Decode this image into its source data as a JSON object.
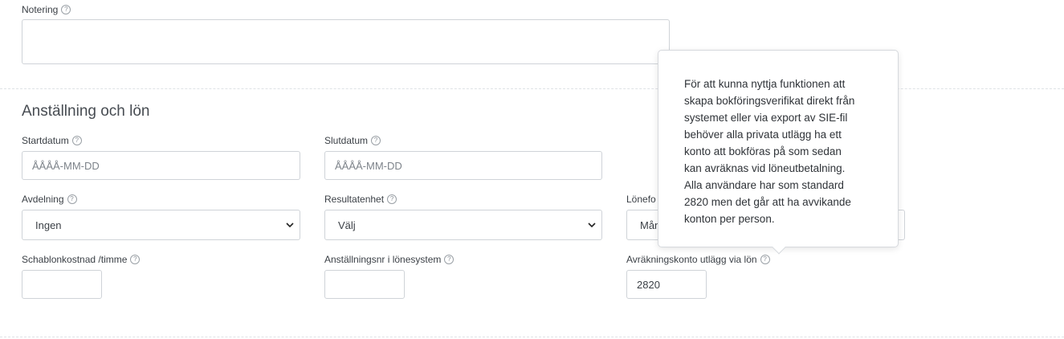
{
  "notes": {
    "label": "Notering",
    "value": ""
  },
  "section": {
    "title": "Anställning och lön"
  },
  "fields": {
    "start_date": {
      "label": "Startdatum",
      "placeholder": "ÅÅÅÅ-MM-DD"
    },
    "end_date": {
      "label": "Slutdatum",
      "placeholder": "ÅÅÅÅ-MM-DD"
    },
    "department": {
      "label": "Avdelning",
      "value": "Ingen"
    },
    "result_unit": {
      "label": "Resultatenhet",
      "value": "Välj"
    },
    "salary_form": {
      "label": "Lönefo",
      "value": "Mån"
    },
    "standard_cost": {
      "label": "Schablonkostnad /timme",
      "value": ""
    },
    "employee_number": {
      "label": "Anställningsnr i lönesystem",
      "value": ""
    },
    "settlement_account": {
      "label": "Avräkningskonto utlägg via lön",
      "value": "2820"
    }
  },
  "tooltip": {
    "lines": [
      "För att kunna nyttja funktionen att",
      "skapa bokföringsverifikat direkt från",
      "systemet eller via export av SIE-fil",
      "behöver alla privata utlägg ha ett",
      "konto att bokföras på som sedan",
      "kan avräknas vid löneutbetalning.",
      "Alla användare har som standard",
      "2820 men det går att ha avvikande",
      "konton per person."
    ]
  },
  "icons": {
    "help": "question-circle-icon",
    "chevron": "chevron-down-icon"
  },
  "help_glyph": "?"
}
